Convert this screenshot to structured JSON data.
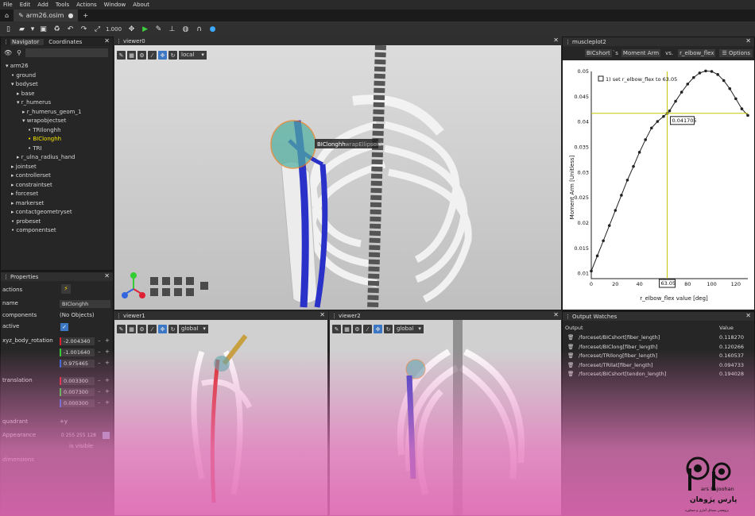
{
  "menu": [
    "File",
    "Edit",
    "Add",
    "Tools",
    "Actions",
    "Window",
    "About"
  ],
  "tabs": {
    "home_icon": "home-icon",
    "file_tab": "arm26.osim",
    "new_tab": "+"
  },
  "toolbar": {
    "zoom_value": "1.000"
  },
  "navigator": {
    "tab1": "Navigator",
    "tab2": "Coordinates",
    "search_placeholder": "",
    "tree": [
      {
        "label": "arm26",
        "indent": 0,
        "arrow": "▾"
      },
      {
        "label": "ground",
        "indent": 1,
        "arrow": "•"
      },
      {
        "label": "bodyset",
        "indent": 1,
        "arrow": "▾"
      },
      {
        "label": "base",
        "indent": 2,
        "arrow": "▸"
      },
      {
        "label": "r_humerus",
        "indent": 2,
        "arrow": "▾"
      },
      {
        "label": "r_humerus_geom_1",
        "indent": 3,
        "arrow": "▸"
      },
      {
        "label": "wrapobjectset",
        "indent": 3,
        "arrow": "▾"
      },
      {
        "label": "TRIlonghh",
        "indent": 4,
        "arrow": "•"
      },
      {
        "label": "BIClonghh",
        "indent": 4,
        "arrow": "•",
        "highlight": true
      },
      {
        "label": "TRI",
        "indent": 4,
        "arrow": "•"
      },
      {
        "label": "r_ulna_radius_hand",
        "indent": 2,
        "arrow": "▸"
      },
      {
        "label": "jointset",
        "indent": 1,
        "arrow": "▸"
      },
      {
        "label": "controllerset",
        "indent": 1,
        "arrow": "▸"
      },
      {
        "label": "constraintset",
        "indent": 1,
        "arrow": "▸"
      },
      {
        "label": "forceset",
        "indent": 1,
        "arrow": "▸"
      },
      {
        "label": "markerset",
        "indent": 1,
        "arrow": "▸"
      },
      {
        "label": "contactgeometryset",
        "indent": 1,
        "arrow": "▸"
      },
      {
        "label": "probeset",
        "indent": 1,
        "arrow": "•"
      },
      {
        "label": "componentset",
        "indent": 1,
        "arrow": "•"
      }
    ]
  },
  "properties": {
    "title": "Properties",
    "actions_label": "actions",
    "name_label": "name",
    "name_value": "BIClonghh",
    "components_label": "components",
    "components_value": "(No Objects)",
    "active_label": "active",
    "xyz_label": "xyz_body_rotation",
    "xyz_values": [
      "-2.004340",
      "-1.001640",
      "0.975465"
    ],
    "translation_label": "translation",
    "translation_values": [
      "0.003300",
      "0.007300",
      "0.000300"
    ],
    "quadrant_label": "quadrant",
    "quadrant_value": "+y",
    "appearance_label": "Appearance",
    "appearance_value": "0 255 255 128",
    "visible_label": "is visible",
    "dimensions_label": "dimensions"
  },
  "viewer0": {
    "title": "viewer0",
    "frame": "local",
    "tooltip_name": "BIClonghh",
    "tooltip_type": "wrapEllipsoid"
  },
  "viewer1": {
    "title": "viewer1",
    "frame": "global"
  },
  "viewer2": {
    "title": "viewer2",
    "frame": "global"
  },
  "muscleplot": {
    "title": "muscleplot2",
    "muscle": "BICshort",
    "output": "Moment Arm",
    "vs": "vs.",
    "coord": "r_elbow_flex",
    "options": "Options",
    "legend": "1) set r_elbow_flex to 63.05",
    "hover_value": "0.041705",
    "x_hover": "63.05"
  },
  "chart_data": {
    "type": "scatter",
    "xlabel": "r_elbow_flex value [deg]",
    "ylabel": "Moment Arm [Unitless]",
    "xlim": [
      0,
      130
    ],
    "ylim": [
      0.009,
      0.05
    ],
    "xticks": [
      0,
      20,
      40,
      60,
      80,
      100,
      120
    ],
    "yticks": [
      0.01,
      0.015,
      0.02,
      0.025,
      0.03,
      0.035,
      0.04,
      0.045,
      0.05
    ],
    "x": [
      0,
      5,
      10,
      15,
      20,
      25,
      30,
      35,
      40,
      45,
      50,
      55,
      60,
      63.05,
      65,
      70,
      75,
      80,
      85,
      90,
      95,
      100,
      105,
      110,
      115,
      120,
      125,
      130
    ],
    "y": [
      0.0105,
      0.0135,
      0.0165,
      0.0195,
      0.0225,
      0.0255,
      0.0285,
      0.0312,
      0.034,
      0.0365,
      0.0388,
      0.0401,
      0.0411,
      0.041705,
      0.0422,
      0.0441,
      0.0459,
      0.0475,
      0.0488,
      0.0497,
      0.0501,
      0.05,
      0.0494,
      0.0482,
      0.0466,
      0.0446,
      0.0426,
      0.0413
    ]
  },
  "output_watches": {
    "title": "Output Watches",
    "col_output": "Output",
    "col_value": "Value",
    "rows": [
      {
        "output": "/forceset/BICshort[fiber_length]",
        "value": "0.118270"
      },
      {
        "output": "/forceset/BIClong[fiber_length]",
        "value": "0.120266"
      },
      {
        "output": "/forceset/TRIlong[fiber_length]",
        "value": "0.160537"
      },
      {
        "output": "/forceset/TRIlat[fiber_length]",
        "value": "0.094733"
      },
      {
        "output": "/forceset/BICshort[tendon_length]",
        "value": "0.194028"
      }
    ]
  },
  "watermark": {
    "text1": "ars Pajoohan",
    "text2": "پارس پژوهان",
    "text3": "پژوهشی مسائل آماری و مشاوره"
  }
}
